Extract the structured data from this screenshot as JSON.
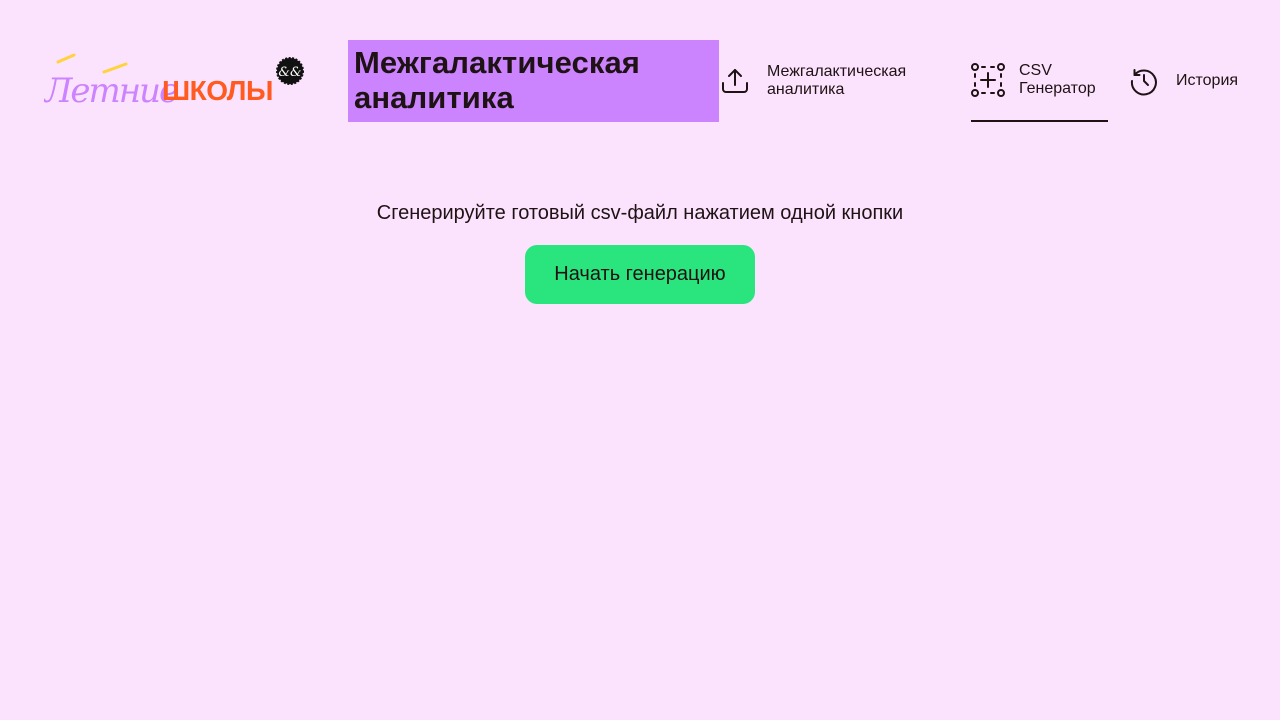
{
  "logo": {
    "word1": "Летние",
    "word2": "ШКОЛЫ",
    "badge": "&&",
    "colors": {
      "purple": "#cb83fe",
      "orange": "#ff5a1f",
      "yellow": "#ffd33d"
    }
  },
  "header": {
    "title": "Межгалактическая аналитика",
    "title_bg": "#cb83fe"
  },
  "nav": {
    "items": [
      {
        "label": "Межгалактическая аналитика",
        "icon": "upload-icon",
        "active": false
      },
      {
        "label": "CSV Генератор",
        "icon": "add-selection-icon",
        "active": true
      },
      {
        "label": "История",
        "icon": "history-icon",
        "active": false
      }
    ]
  },
  "main": {
    "subtitle": "Сгенерируйте готовый csv-файл нажатием одной кнопки",
    "button_label": "Начать генерацию",
    "button_color": "#2ae57e"
  },
  "colors": {
    "background": "#fce3fd",
    "text": "#1e1214"
  }
}
